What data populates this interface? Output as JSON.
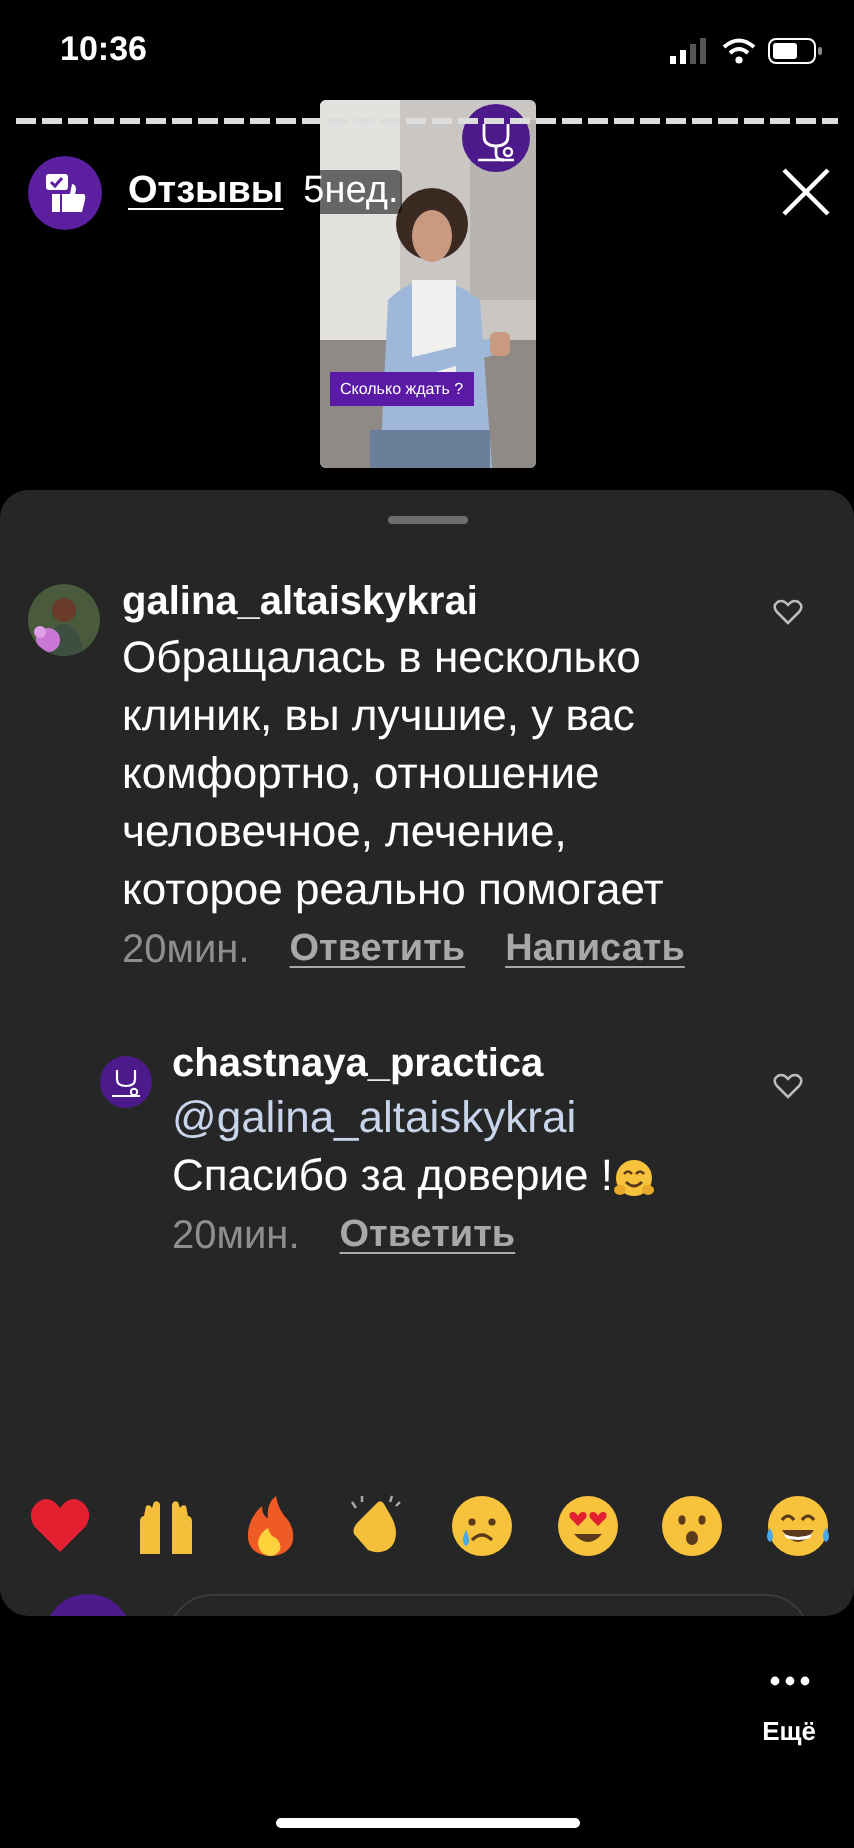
{
  "status_bar": {
    "time": "10:36"
  },
  "header": {
    "title": "Отзывы",
    "age": "5нед."
  },
  "story_preview": {
    "button": "Сколько ждать ?"
  },
  "comments": [
    {
      "username": "galina_altaiskykrai",
      "text": "Обращалась в несколько клиник, вы лучшие, у вас комфортно, отношение человечное, лечение, которое реально помогает",
      "time": "20мин.",
      "actions": [
        "Ответить",
        "Написать"
      ],
      "liked": false,
      "replies": [
        {
          "username": "chastnaya_practica",
          "mention": "@galina_altaiskykrai",
          "text": "Спасибо за доверие !",
          "time": "20мин.",
          "actions": [
            "Ответить"
          ],
          "liked": false
        }
      ]
    }
  ],
  "reactions": [
    {
      "kind": "heart"
    },
    {
      "kind": "raised-hands"
    },
    {
      "kind": "fire"
    },
    {
      "kind": "clap"
    },
    {
      "kind": "crying"
    },
    {
      "kind": "heart-eyes"
    },
    {
      "kind": "surprised"
    },
    {
      "kind": "tears-of-joy"
    }
  ],
  "footer": {
    "more_label": "Ещё"
  }
}
